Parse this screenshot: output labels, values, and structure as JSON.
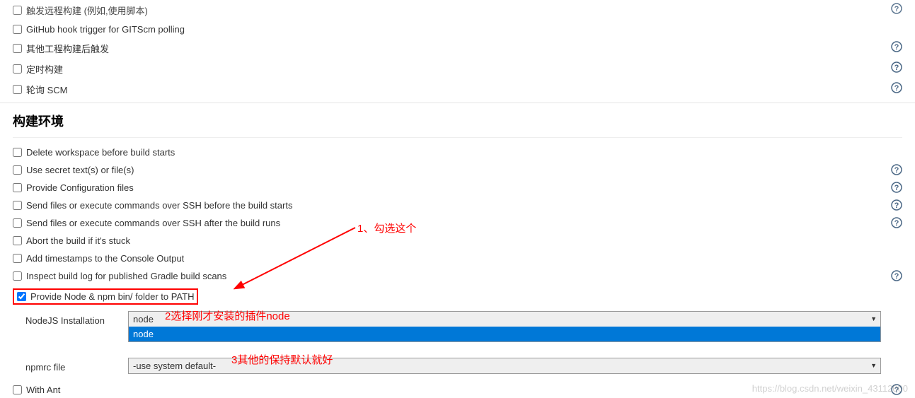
{
  "triggers": {
    "items": [
      {
        "label": "触发远程构建 (例如,使用脚本)",
        "checked": false,
        "help": true
      },
      {
        "label": "GitHub hook trigger for GITScm polling",
        "checked": false,
        "help": false
      },
      {
        "label": "其他工程构建后触发",
        "checked": false,
        "help": true
      },
      {
        "label": "定时构建",
        "checked": false,
        "help": true
      },
      {
        "label": "轮询 SCM",
        "checked": false,
        "help": true
      }
    ]
  },
  "build_env": {
    "title": "构建环境",
    "items": [
      {
        "label": "Delete workspace before build starts",
        "checked": false,
        "help": false
      },
      {
        "label": "Use secret text(s) or file(s)",
        "checked": false,
        "help": true
      },
      {
        "label": "Provide Configuration files",
        "checked": false,
        "help": true
      },
      {
        "label": "Send files or execute commands over SSH before the build starts",
        "checked": false,
        "help": true
      },
      {
        "label": "Send files or execute commands over SSH after the build runs",
        "checked": false,
        "help": true
      },
      {
        "label": "Abort the build if it's stuck",
        "checked": false,
        "help": false
      },
      {
        "label": "Add timestamps to the Console Output",
        "checked": false,
        "help": false
      },
      {
        "label": "Inspect build log for published Gradle build scans",
        "checked": false,
        "help": true
      },
      {
        "label": "Provide Node & npm bin/ folder to PATH",
        "checked": true,
        "help": false,
        "highlight": true
      }
    ]
  },
  "node_config": {
    "installation_label": "NodeJS Installation",
    "installation_selected": "node",
    "installation_option": "node",
    "npmrc_label": "npmrc file",
    "npmrc_value": "-use system default-"
  },
  "with_ant": {
    "label": "With Ant",
    "checked": false,
    "help": true
  },
  "annotations": {
    "a1": "1、勾选这个",
    "a2": "2选择刚才安装的插件node",
    "a3": "3其他的保持默认就好"
  },
  "watermark": "https://blog.csdn.net/weixin_43112000"
}
